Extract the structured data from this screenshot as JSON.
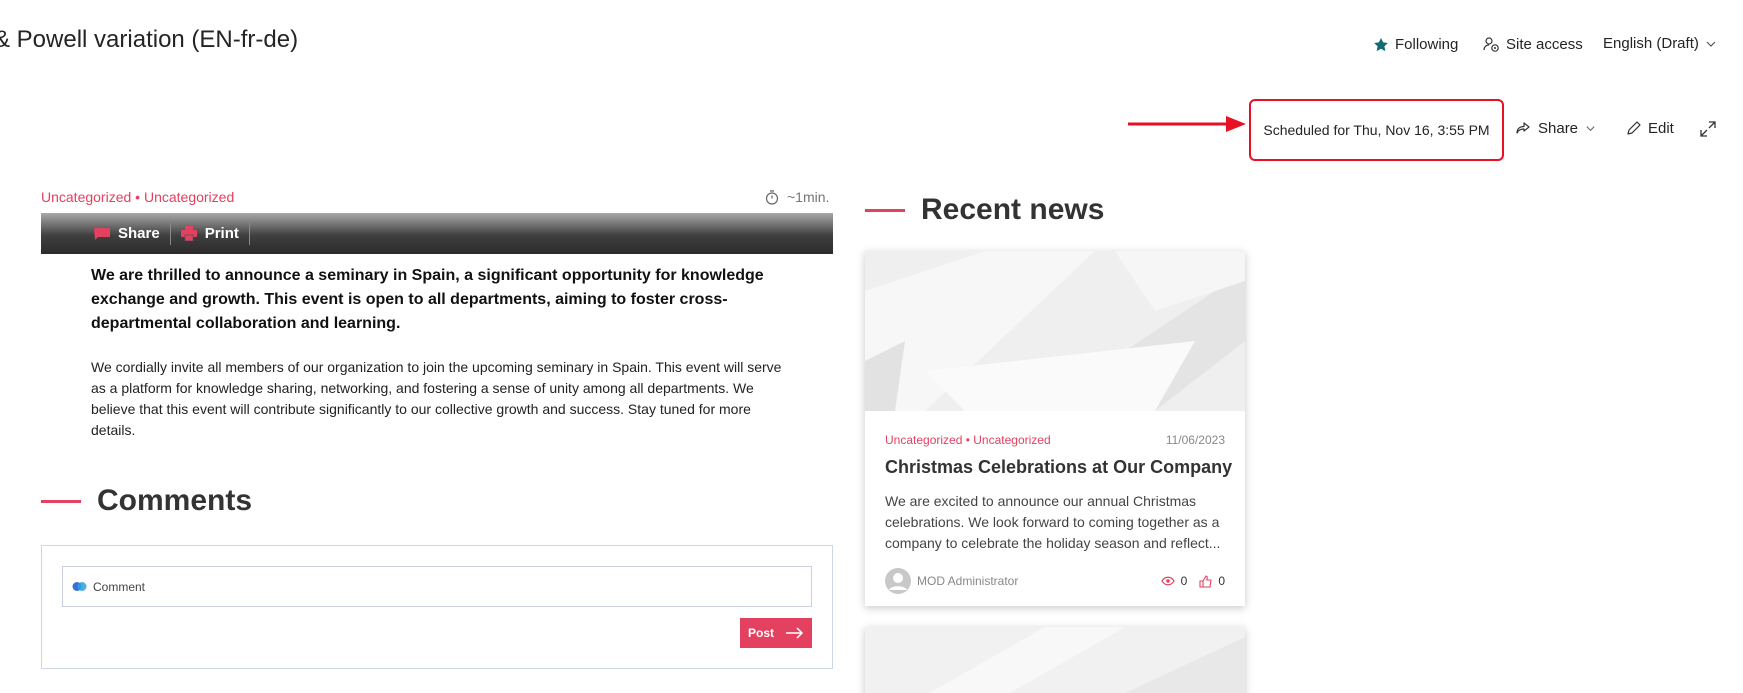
{
  "header": {
    "title": "& Powell variation (EN-fr-de)",
    "following_label": "Following",
    "site_access_label": "Site access",
    "language_label": "English (Draft)"
  },
  "command_bar": {
    "scheduled_text": "Scheduled for Thu, Nov 16, 3:55 PM",
    "share_label": "Share",
    "edit_label": "Edit"
  },
  "article": {
    "categories": "Uncategorized • Uncategorized",
    "read_time": "~1min.",
    "share_label": "Share",
    "print_label": "Print",
    "lead": "We are thrilled to announce a seminary in Spain, a significant opportunity for knowledge exchange and growth. This event is open to all departments, aiming to foster cross-departmental collaboration and learning.",
    "body": "We cordially invite all members of our organization to join the upcoming seminary in Spain. This event will serve as a platform for knowledge sharing, networking, and fostering a sense of unity among all departments. We believe that this event will contribute significantly to our collective growth and success. Stay tuned for more details."
  },
  "comments": {
    "heading": "Comments",
    "placeholder": "Comment",
    "post_label": "Post"
  },
  "recent_news": {
    "heading": "Recent news",
    "cards": [
      {
        "categories": "Uncategorized  •  Uncategorized",
        "date": "11/06/2023",
        "title": "Christmas Celebrations at Our Company",
        "excerpt": "We are excited to announce our annual Christmas celebrations. We look forward to coming together as a company to celebrate the holiday season and reflect...",
        "author": "MOD Administrator",
        "views": "0",
        "likes": "0"
      }
    ]
  },
  "colors": {
    "accent": "#e4405f",
    "highlight_border": "#e81123",
    "following_star": "#0f6b74"
  }
}
